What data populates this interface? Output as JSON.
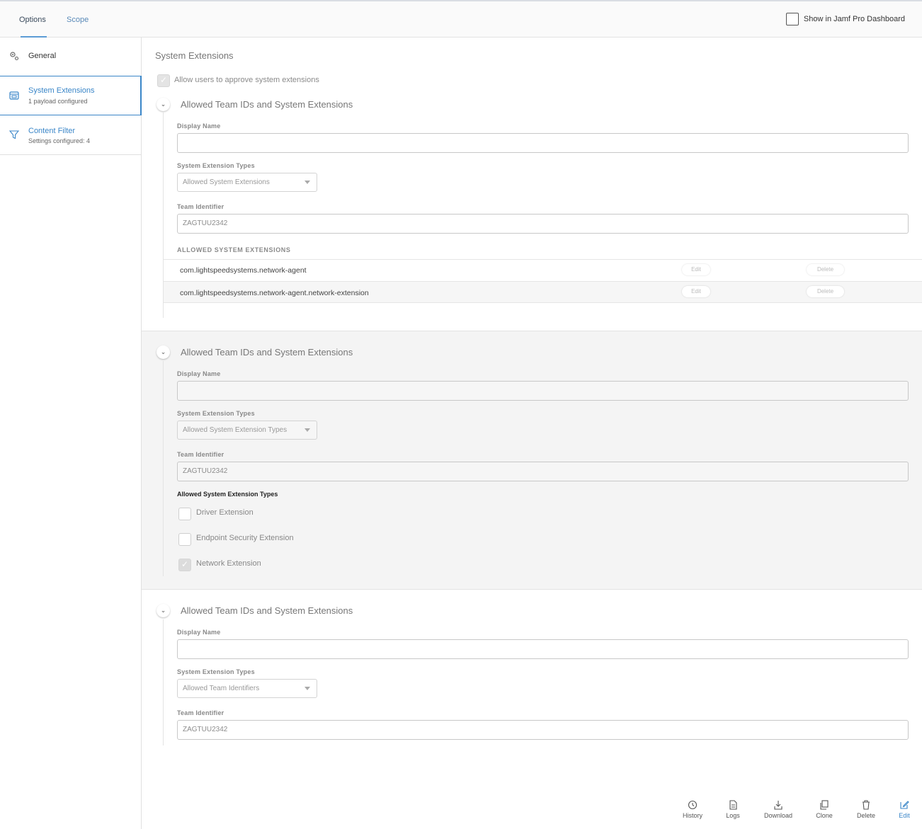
{
  "tabs": {
    "options": "Options",
    "scope": "Scope"
  },
  "dashboard": {
    "label": "Show in Jamf Pro Dashboard",
    "checked": false
  },
  "sidebar": {
    "items": [
      {
        "label": "General",
        "sub": "",
        "icon": "gear-icon"
      },
      {
        "label": "System Extensions",
        "sub": "1 payload configured",
        "icon": "extension-icon"
      },
      {
        "label": "Content Filter",
        "sub": "Settings configured: 4",
        "icon": "filter-icon"
      }
    ]
  },
  "main": {
    "title": "System Extensions",
    "allow_users": "Allow users to approve system extensions",
    "blocks": [
      {
        "title": "Allowed Team IDs and System Extensions",
        "display_name_label": "Display Name",
        "display_name_value": "",
        "types_label": "System Extension Types",
        "types_value": "Allowed System Extensions",
        "team_label": "Team Identifier",
        "team_value": "ZAGTUU2342",
        "list_heading": "ALLOWED SYSTEM EXTENSIONS",
        "rows": [
          {
            "name": "com.lightspeedsystems.network-agent",
            "edit": "Edit",
            "delete": "Delete"
          },
          {
            "name": "com.lightspeedsystems.network-agent.network-extension",
            "edit": "Edit",
            "delete": "Delete"
          }
        ]
      },
      {
        "title": "Allowed Team IDs and System Extensions",
        "display_name_label": "Display Name",
        "display_name_value": "",
        "types_label": "System Extension Types",
        "types_value": "Allowed System Extension Types",
        "team_label": "Team Identifier",
        "team_value": "ZAGTUU2342",
        "options_heading": "Allowed System Extension Types",
        "options": [
          {
            "label": "Driver Extension",
            "checked": false
          },
          {
            "label": "Endpoint Security Extension",
            "checked": false
          },
          {
            "label": "Network Extension",
            "checked": true
          }
        ]
      },
      {
        "title": "Allowed Team IDs and System Extensions",
        "display_name_label": "Display Name",
        "display_name_value": "",
        "types_label": "System Extension Types",
        "types_value": "Allowed Team Identifiers",
        "team_label": "Team Identifier",
        "team_value": "ZAGTUU2342"
      }
    ]
  },
  "toolbar": {
    "history": "History",
    "logs": "Logs",
    "download": "Download",
    "clone": "Clone",
    "delete": "Delete",
    "edit": "Edit"
  },
  "colors": {
    "accent": "#3a86c8",
    "muted": "#888888"
  }
}
